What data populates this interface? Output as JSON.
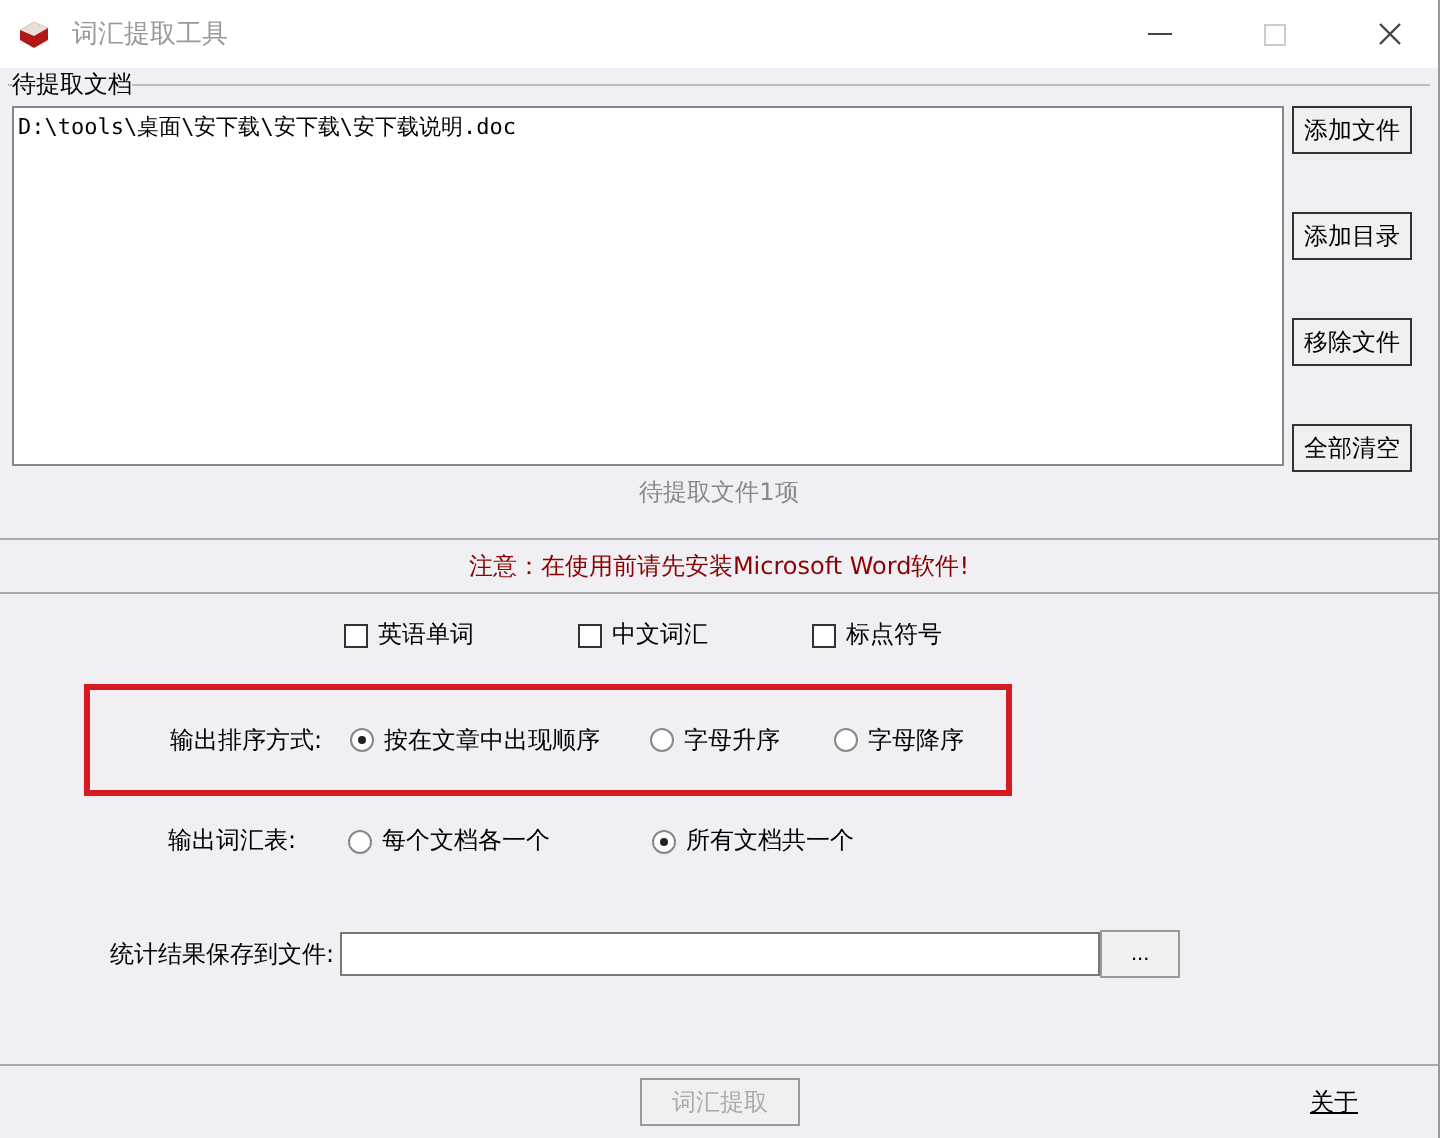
{
  "window": {
    "title": "词汇提取工具"
  },
  "documents": {
    "label": "待提取文档",
    "items": [
      "D:\\tools\\桌面\\安下载\\安下载\\安下载说明.doc"
    ],
    "buttons": [
      "添加文件",
      "添加目录",
      "移除文件",
      "全部清空"
    ],
    "count": "待提取文件1项"
  },
  "notice": "注意：在使用前请先安装Microsoft Word软件!",
  "include": [
    {
      "label": "英语单词",
      "checked": false
    },
    {
      "label": "中文词汇",
      "checked": false
    },
    {
      "label": "标点符号",
      "checked": false
    }
  ],
  "sort": {
    "label": "输出排序方式:",
    "options": [
      {
        "label": "按在文章中出现顺序",
        "selected": true
      },
      {
        "label": "字母升序",
        "selected": false
      },
      {
        "label": "字母降序",
        "selected": false
      }
    ]
  },
  "output": {
    "label": "输出词汇表:",
    "options": [
      {
        "label": "每个文档各一个",
        "selected": false
      },
      {
        "label": "所有文档共一个",
        "selected": true
      }
    ]
  },
  "save": {
    "label": "统计结果保存到文件:",
    "browse": "..."
  },
  "extract_button": {
    "label": "词汇提取",
    "disabled": true
  },
  "about_link": "关于"
}
